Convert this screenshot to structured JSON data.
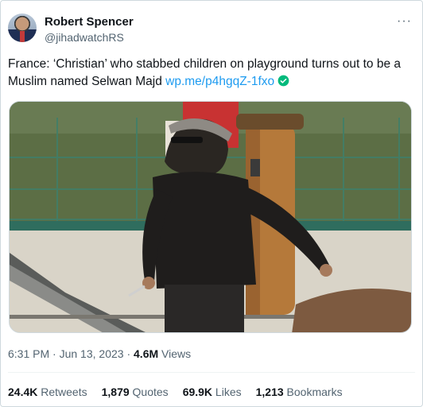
{
  "author": {
    "display_name": "Robert Spencer",
    "handle": "@jihadwatchRS",
    "avatar_icon": "user-avatar"
  },
  "more_icon": "more-options-icon",
  "tweet": {
    "text": "France: ‘Christian’ who stabbed children on playground turns out to be a Muslim named Selwan Majd ",
    "link": "wp.me/p4hgqZ-1fxo",
    "link_badge_icon": "verified-check-icon",
    "link_badge_color": "#00ba7c"
  },
  "media": {
    "kind": "video-still",
    "description_icon": "photo-icon"
  },
  "meta": {
    "time": "6:31 PM",
    "separator": " · ",
    "date": "Jun 13, 2023",
    "views_count": "4.6M",
    "views_label": " Views"
  },
  "stats": [
    {
      "count": "24.4K",
      "label": " Retweets"
    },
    {
      "count": "1,879",
      "label": " Quotes"
    },
    {
      "count": "69.9K",
      "label": " Likes"
    },
    {
      "count": "1,213",
      "label": " Bookmarks"
    }
  ],
  "colors": {
    "text_primary": "#0f1419",
    "text_secondary": "#536471",
    "link": "#1d9bf0",
    "border": "#cfd9de"
  }
}
